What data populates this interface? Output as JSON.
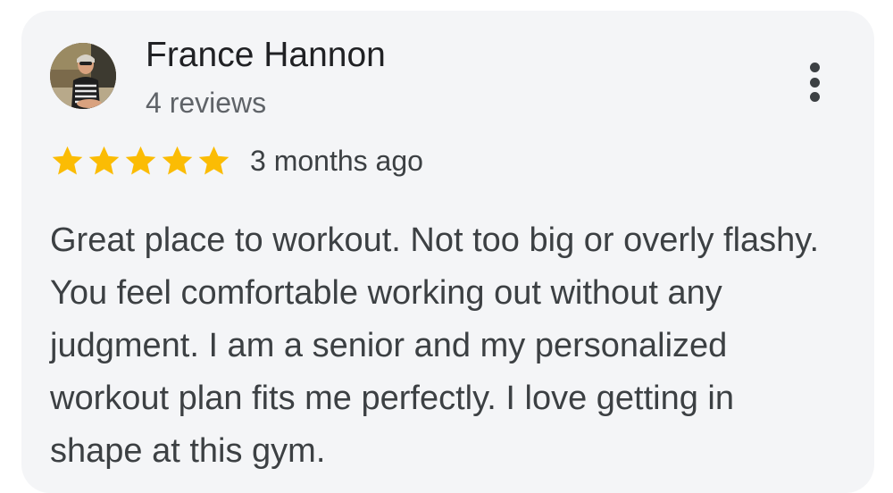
{
  "review": {
    "author_name": "France Hannon",
    "author_review_count": "4 reviews",
    "rating": 5,
    "rating_max": 5,
    "time_ago": "3 months ago",
    "text": "Great place to workout. Not too big or overly flashy. You feel comfortable working out without any judgment. I am a senior and my personalized workout plan fits me perfectly. I love getting in shape at this gym."
  },
  "icons": {
    "more": "more-vert-icon",
    "star": "star-icon",
    "avatar": "avatar-photo"
  },
  "colors": {
    "card_background": "#f4f5f7",
    "star": "#fbbc04",
    "name_text": "#202124",
    "secondary_text": "#5f6368",
    "body_text": "#3c4043"
  }
}
